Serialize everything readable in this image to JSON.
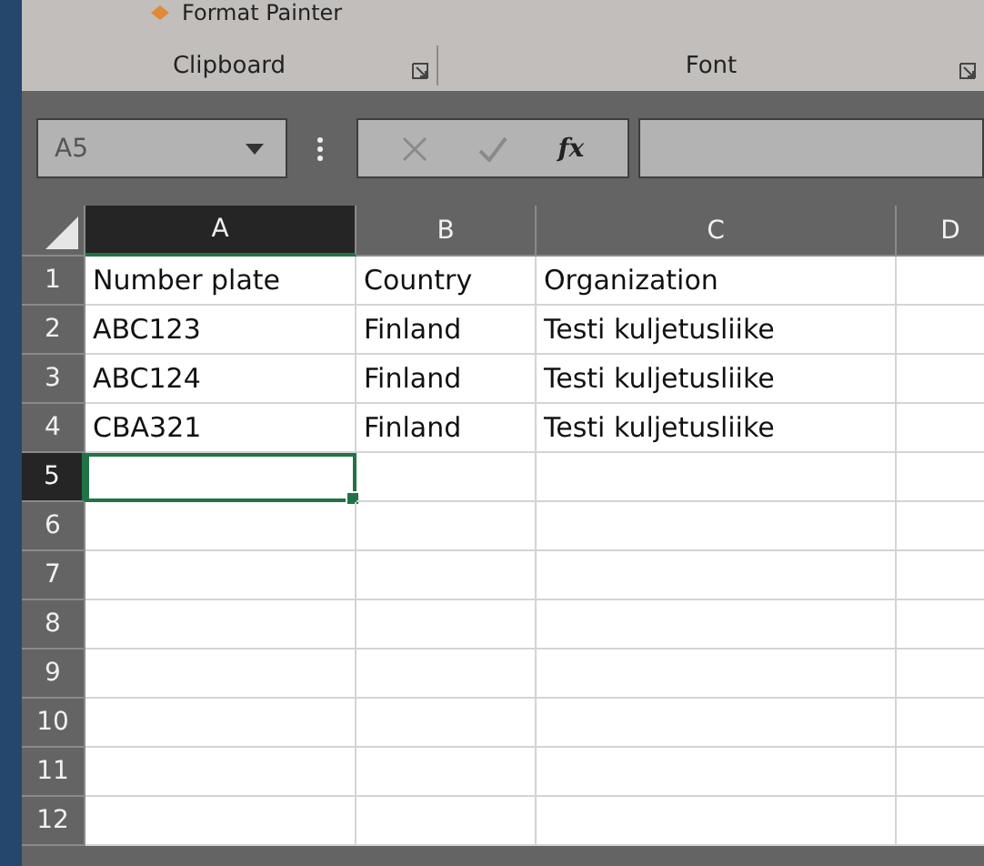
{
  "ribbon": {
    "top_item": "Format Painter",
    "groups": [
      {
        "label": "Clipboard"
      },
      {
        "label": "Font"
      }
    ]
  },
  "formula_bar": {
    "name_box": "A5",
    "function_label": "fx"
  },
  "columns": [
    {
      "label": "A",
      "selected": true
    },
    {
      "label": "B",
      "selected": false
    },
    {
      "label": "C",
      "selected": false
    },
    {
      "label": "D",
      "selected": false
    }
  ],
  "rows": [
    {
      "number": "1",
      "selected": false,
      "cells": [
        "Number plate",
        "Country",
        "Organization",
        ""
      ]
    },
    {
      "number": "2",
      "selected": false,
      "cells": [
        "ABC123",
        "Finland",
        "Testi kuljetusliike",
        ""
      ]
    },
    {
      "number": "3",
      "selected": false,
      "cells": [
        "ABC124",
        "Finland",
        "Testi kuljetusliike",
        ""
      ]
    },
    {
      "number": "4",
      "selected": false,
      "cells": [
        "CBA321",
        "Finland",
        "Testi kuljetusliike",
        ""
      ]
    },
    {
      "number": "5",
      "selected": true,
      "cells": [
        "",
        "",
        "",
        ""
      ]
    },
    {
      "number": "6",
      "selected": false,
      "cells": [
        "",
        "",
        "",
        ""
      ]
    },
    {
      "number": "7",
      "selected": false,
      "cells": [
        "",
        "",
        "",
        ""
      ]
    },
    {
      "number": "8",
      "selected": false,
      "cells": [
        "",
        "",
        "",
        ""
      ]
    },
    {
      "number": "9",
      "selected": false,
      "cells": [
        "",
        "",
        "",
        ""
      ]
    },
    {
      "number": "10",
      "selected": false,
      "cells": [
        "",
        "",
        "",
        ""
      ]
    },
    {
      "number": "11",
      "selected": false,
      "cells": [
        "",
        "",
        "",
        ""
      ]
    },
    {
      "number": "12",
      "selected": false,
      "cells": [
        "",
        "",
        "",
        ""
      ]
    }
  ]
}
